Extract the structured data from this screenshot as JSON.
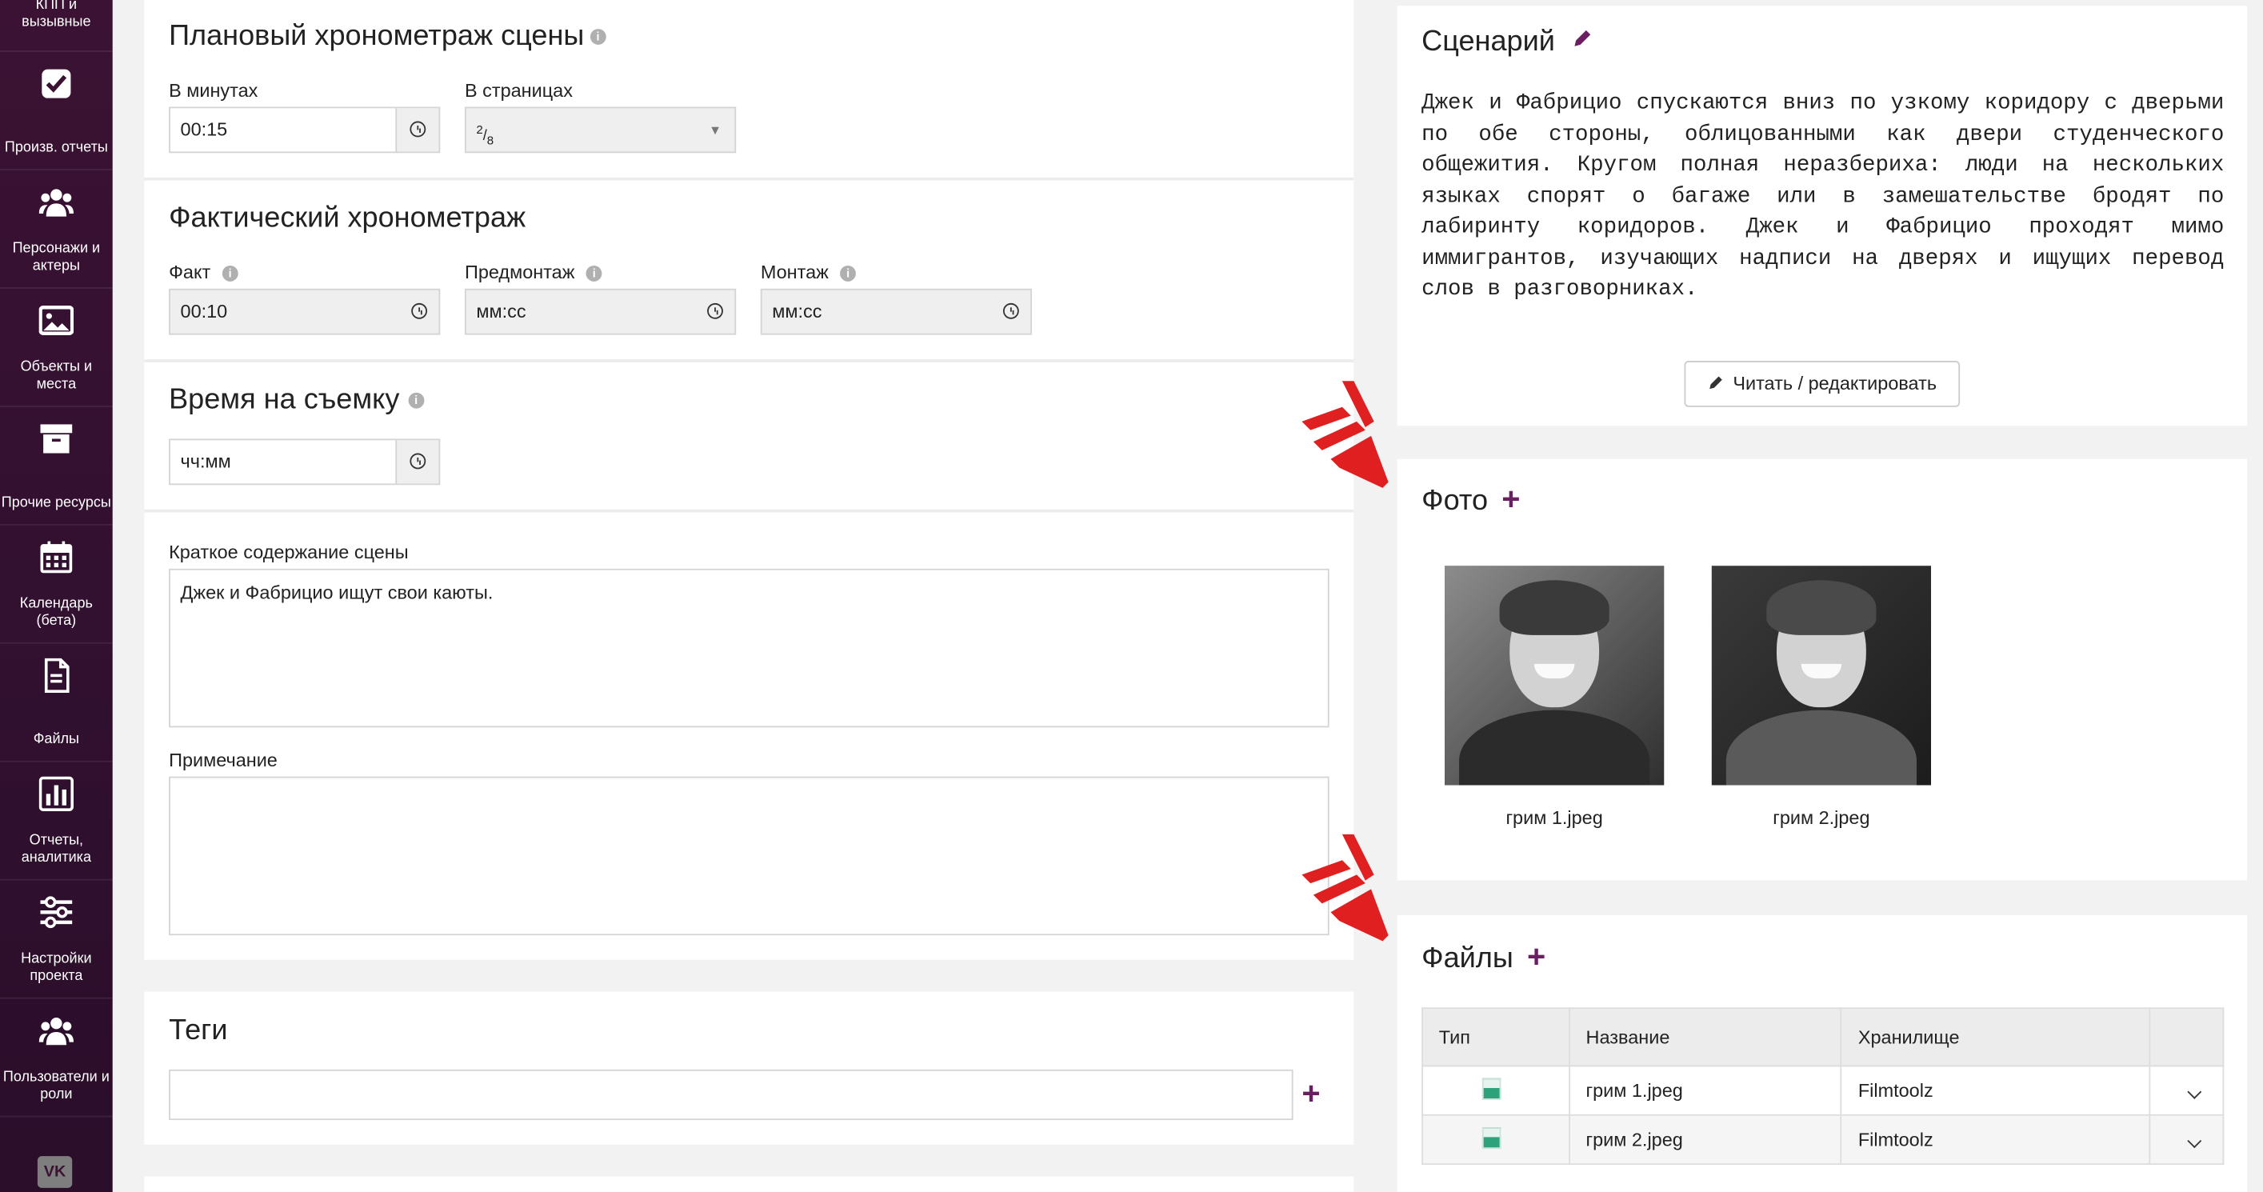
{
  "sidebar": {
    "items": [
      {
        "label": "КПП и вызывные",
        "icon": "callsheet-icon"
      },
      {
        "label": "Произв. отчеты",
        "icon": "checkbox-icon"
      },
      {
        "label": "Персонажи и актеры",
        "icon": "people-icon"
      },
      {
        "label": "Объекты и места",
        "icon": "image-icon"
      },
      {
        "label": "Прочие ресурсы",
        "icon": "archive-icon"
      },
      {
        "label": "Календарь (бета)",
        "icon": "calendar-icon"
      },
      {
        "label": "Файлы",
        "icon": "file-icon"
      },
      {
        "label": "Отчеты, аналитика",
        "icon": "chart-icon"
      },
      {
        "label": "Настройки проекта",
        "icon": "sliders-icon"
      },
      {
        "label": "Пользователи и роли",
        "icon": "users-icon"
      }
    ],
    "vk_label": "VK"
  },
  "planned": {
    "title": "Плановый хронометраж сцены",
    "minutes_label": "В минутах",
    "minutes_value": "00:15",
    "pages_label": "В страницах",
    "pages_num": "2",
    "pages_den": "8"
  },
  "actual": {
    "title": "Фактический хронометраж",
    "fact_label": "Факт",
    "fact_value": "00:10",
    "premontage_label": "Предмонтаж",
    "premontage_placeholder": "мм:сс",
    "montage_label": "Монтаж",
    "montage_placeholder": "мм:сс"
  },
  "shoot": {
    "title": "Время на съемку",
    "placeholder": "чч:мм"
  },
  "summary": {
    "label": "Краткое содержание сцены",
    "value": "Джек и Фабрицио ищут свои каюты."
  },
  "note": {
    "label": "Примечание",
    "value": ""
  },
  "tags": {
    "title": "Теги",
    "add": "+"
  },
  "script": {
    "title": "Сценарий",
    "text": "Джек и Фабрицио спускаются вниз по узкому коридору с дверьми по обе стороны, облицованными как двери студенческого общежития. Кругом полная неразбериха: люди на нескольких языках спорят о багаже или в замешательстве бродят по лабиринту коридоров. Джек и Фабрицио проходят мимо иммигрантов, изучающих надписи на дверях и ищущих перевод слов в разговорниках.",
    "read_button": "Читать / редактировать"
  },
  "photos": {
    "title": "Фото",
    "add": "+",
    "items": [
      {
        "caption": "грим 1.jpeg"
      },
      {
        "caption": "грим 2.jpeg"
      }
    ]
  },
  "files": {
    "title": "Файлы",
    "add": "+",
    "columns": [
      "Тип",
      "Название",
      "Хранилище"
    ],
    "rows": [
      {
        "name": "грим 1.jpeg",
        "storage": "Filmtoolz"
      },
      {
        "name": "грим 2.jpeg",
        "storage": "Filmtoolz"
      }
    ]
  },
  "colors": {
    "sidebar": "#3b1233",
    "accent": "#6b1f63",
    "arrow": "#e02020"
  }
}
